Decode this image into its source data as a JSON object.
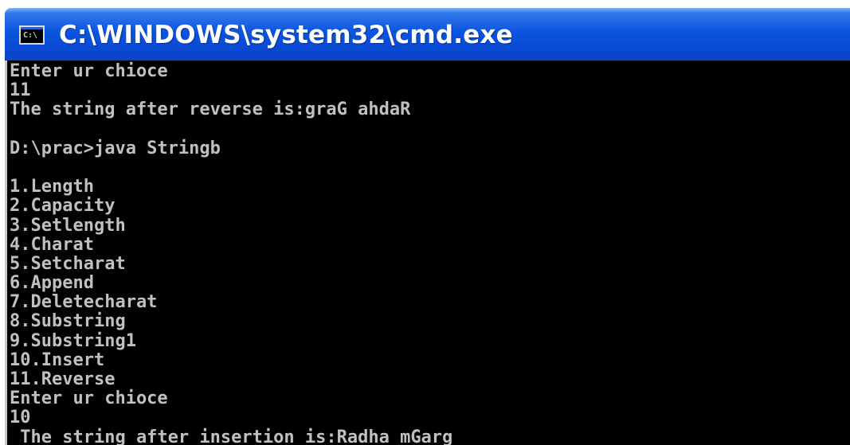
{
  "window": {
    "title": "C:\\WINDOWS\\system32\\cmd.exe",
    "icon_label": "C:\\",
    "icon_name": "console-app-icon"
  },
  "console": {
    "lines": [
      "Enter ur chioce",
      "11",
      "The string after reverse is:graG ahdaR",
      "",
      "D:\\prac>java Stringb",
      "",
      "1.Length",
      "2.Capacity",
      "3.Setlength",
      "4.Charat",
      "5.Setcharat",
      "6.Append",
      "7.Deletecharat",
      "8.Substring",
      "9.Substring1",
      "10.Insert",
      "11.Reverse",
      "Enter ur chioce",
      "10",
      " The string after insertion is:Radha mGarg"
    ]
  },
  "colors": {
    "titlebar": "#0b55e0",
    "console_bg": "#000000",
    "console_text": "#c0c0c0"
  }
}
